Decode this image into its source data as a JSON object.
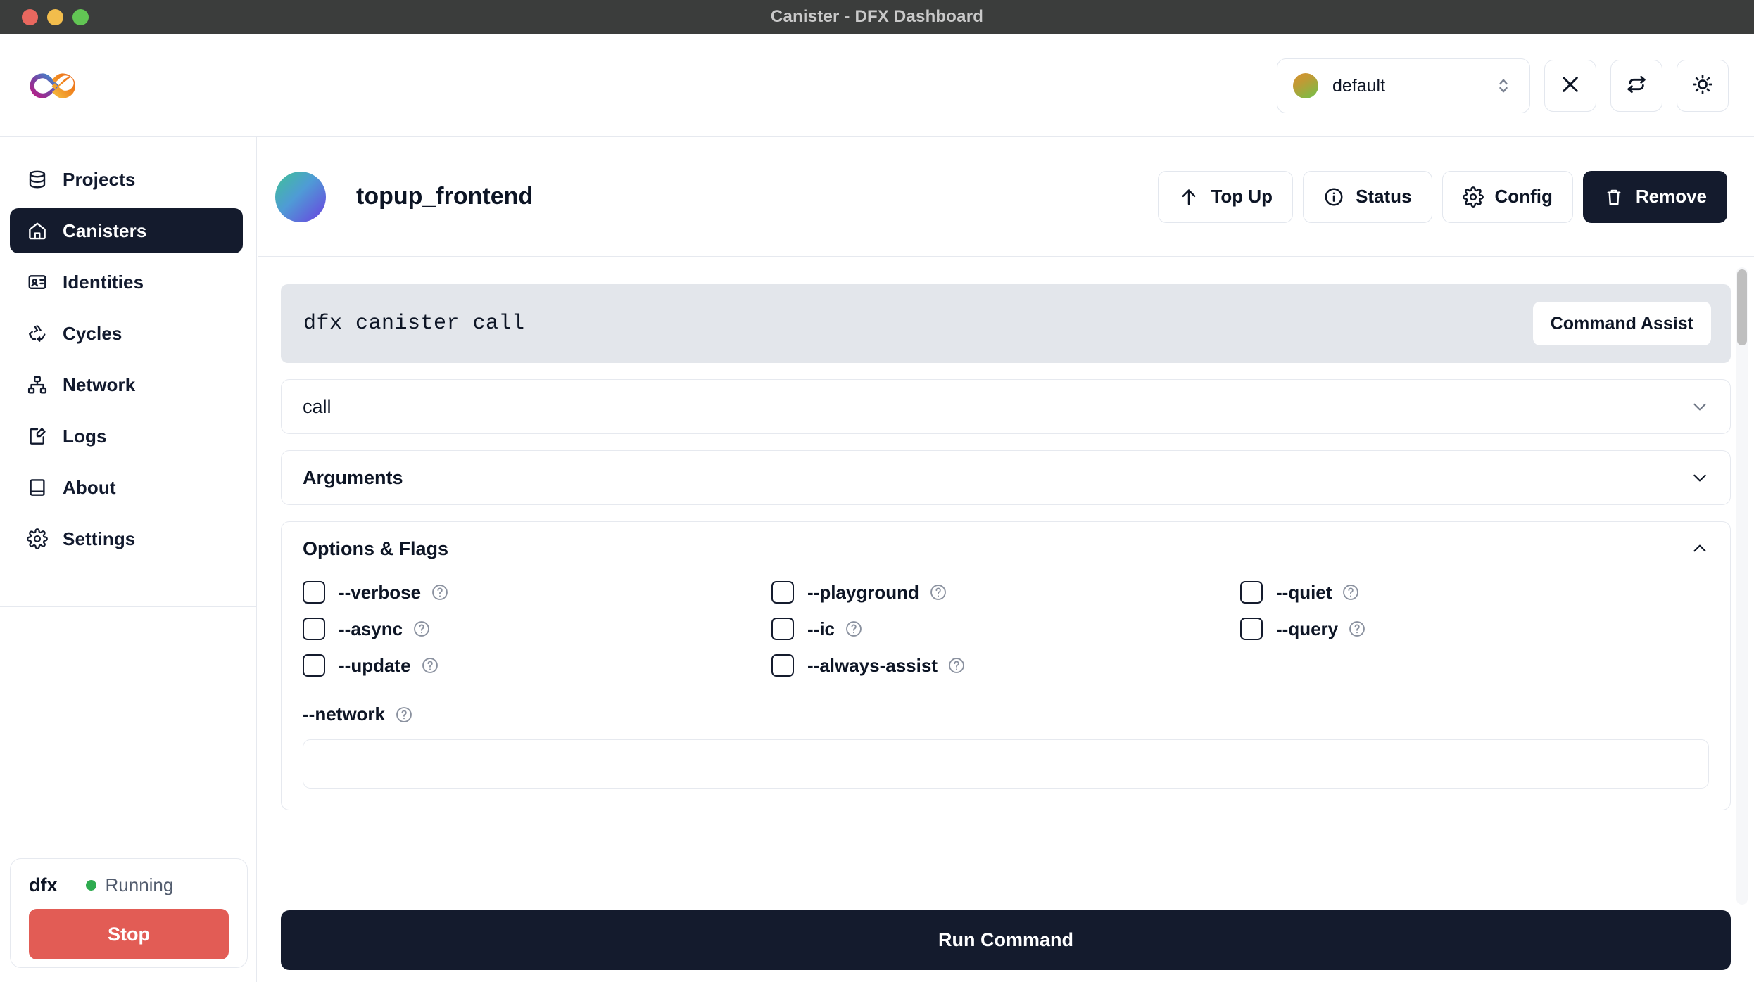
{
  "window": {
    "title": "Canister - DFX Dashboard",
    "traffic_lights": [
      "close-button",
      "minimize-button",
      "maximize-button"
    ]
  },
  "topbar": {
    "logo": "infinity-logo",
    "identity": {
      "selected": "default",
      "avatar": "identity-avatar",
      "chevron": "up-down-chevron-icon"
    },
    "buttons": [
      {
        "name": "close-button",
        "icon": "close-icon"
      },
      {
        "name": "refresh-button",
        "icon": "refresh-icon"
      },
      {
        "name": "theme-toggle-button",
        "icon": "sun-icon"
      }
    ]
  },
  "sidebar": {
    "items": [
      {
        "label": "Projects",
        "icon": "database-icon",
        "active": false
      },
      {
        "label": "Canisters",
        "icon": "home-icon",
        "active": true
      },
      {
        "label": "Identities",
        "icon": "id-card-icon",
        "active": false
      },
      {
        "label": "Cycles",
        "icon": "recycle-icon",
        "active": false
      },
      {
        "label": "Network",
        "icon": "network-icon",
        "active": false
      },
      {
        "label": "Logs",
        "icon": "logs-icon",
        "active": false
      },
      {
        "label": "About",
        "icon": "book-icon",
        "active": false
      },
      {
        "label": "Settings",
        "icon": "gear-icon",
        "active": false
      }
    ],
    "dfx": {
      "label": "dfx",
      "status": "Running",
      "status_color": "#2eab4f",
      "stop_label": "Stop",
      "stop_color": "#e25c55"
    }
  },
  "canister": {
    "name": "topup_frontend",
    "actions": [
      {
        "label": "Top Up",
        "icon": "arrow-up-icon",
        "primary": false
      },
      {
        "label": "Status",
        "icon": "info-icon",
        "primary": false
      },
      {
        "label": "Config",
        "icon": "gear-icon",
        "primary": false
      },
      {
        "label": "Remove",
        "icon": "trash-icon",
        "primary": true
      }
    ]
  },
  "command": {
    "text": "dfx canister call",
    "assist_label": "Command Assist"
  },
  "sections": [
    {
      "title": "call",
      "chevron": "chevron-down-icon",
      "bold": false
    },
    {
      "title": "Arguments",
      "chevron": "chevron-down-icon",
      "bold": false
    }
  ],
  "options": {
    "title": "Options & Flags",
    "chevron": "chevron-up-icon",
    "flags": [
      {
        "label": "--verbose",
        "checked": false,
        "help": "help-icon"
      },
      {
        "label": "--playground",
        "checked": false,
        "help": "help-icon"
      },
      {
        "label": "--quiet",
        "checked": false,
        "help": "help-icon"
      },
      {
        "label": "--async",
        "checked": false,
        "help": "help-icon"
      },
      {
        "label": "--ic",
        "checked": false,
        "help": "help-icon"
      },
      {
        "label": "--query",
        "checked": false,
        "help": "help-icon"
      },
      {
        "label": "--update",
        "checked": false,
        "help": "help-icon"
      },
      {
        "label": "--always-assist",
        "checked": false,
        "help": "help-icon"
      },
      {
        "label": "",
        "checked": null,
        "help": ""
      }
    ],
    "network_field": {
      "label": "--network",
      "help": "help-icon",
      "value": "",
      "placeholder": ""
    }
  },
  "footer": {
    "run_label": "Run Command"
  },
  "colors": {
    "accent_dark": "#141b2d",
    "danger": "#e25c55",
    "success": "#2eab4f",
    "border": "#e6e9ef",
    "command_bar": "#e3e6eb"
  }
}
